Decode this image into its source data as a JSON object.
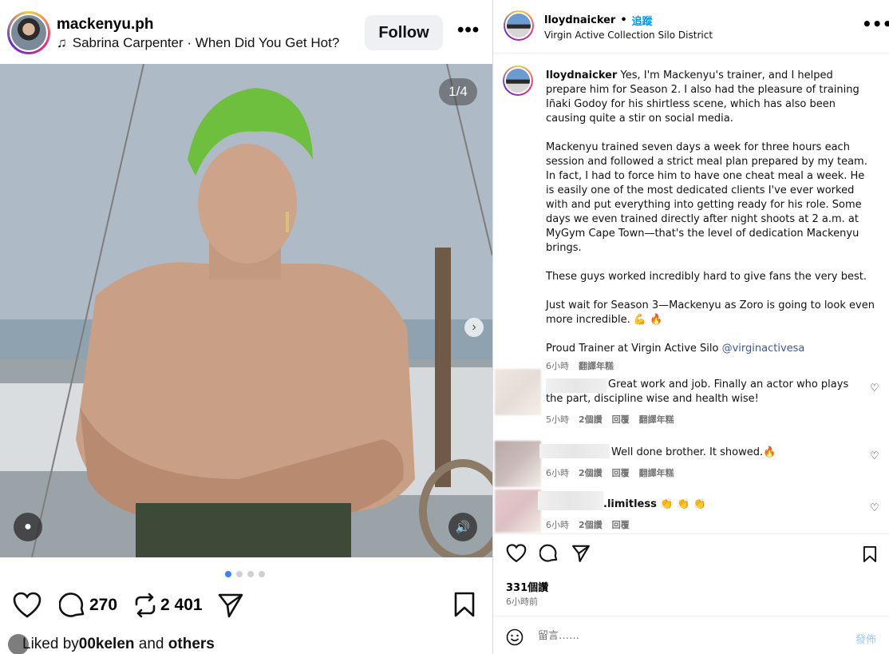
{
  "left": {
    "username": "mackenyu.ph",
    "music": "Sabrina Carpenter · When Did You Get Hot?",
    "follow_label": "Follow",
    "more_label": "•••",
    "counter": "1/4",
    "comment_count": "270",
    "repost_count": "2 401",
    "liked_by_prefix": "Liked by ",
    "liked_by_user": "00kelen",
    "liked_by_and": " and ",
    "liked_by_others": "others"
  },
  "right": {
    "username": "lloydnaicker",
    "dot": "•",
    "follow_label": "追蹤",
    "location": "Virgin Active Collection Silo District",
    "more_label": "•••",
    "caption": {
      "user": "lloydnaicker",
      "p1": "Yes, I'm Mackenyu's trainer, and I helped prepare him for Season 2. I also had the pleasure of training Iñaki Godoy for his shirtless scene, which has also been causing quite a stir on social media.",
      "p2": "Mackenyu trained seven days a week for three hours each session and followed a strict meal plan prepared by my team. In fact, I had to force him to have one cheat meal a week. He is easily one of the most dedicated clients I've ever worked with and put everything into getting ready for his role. Some days we even trained directly after night shoots at 2 a.m. at MyGym Cape Town—that's the level of dedication Mackenyu brings.",
      "p3": "These guys worked incredibly hard to give fans the very best.",
      "p4": "Just wait for Season 3—Mackenyu as Zoro is going to look even more incredible. 💪 🔥",
      "p5_text": "Proud Trainer at Virgin Active Silo ",
      "p5_mention": "@virginactivesa",
      "time": "6小時",
      "translate": "翻譯年糕"
    },
    "comments": [
      {
        "text": "Great work and job. Finally an actor who plays the part, discipline wise and health wise!",
        "time": "5小時",
        "likes": "2個讚",
        "reply": "回覆",
        "translate": "翻譯年糕"
      },
      {
        "text": "Well done brother. It showed.🔥",
        "time": "6小時",
        "likes": "2個讚",
        "reply": "回覆",
        "translate": "翻譯年糕"
      },
      {
        "text": ".limitless 👏 👏 👏",
        "time": "6小時",
        "likes": "2個讚",
        "reply": "回覆"
      }
    ],
    "likes_count": "331個讚",
    "time_ago": "6小時前",
    "comment_placeholder": "留言……",
    "post_label": "發佈"
  }
}
